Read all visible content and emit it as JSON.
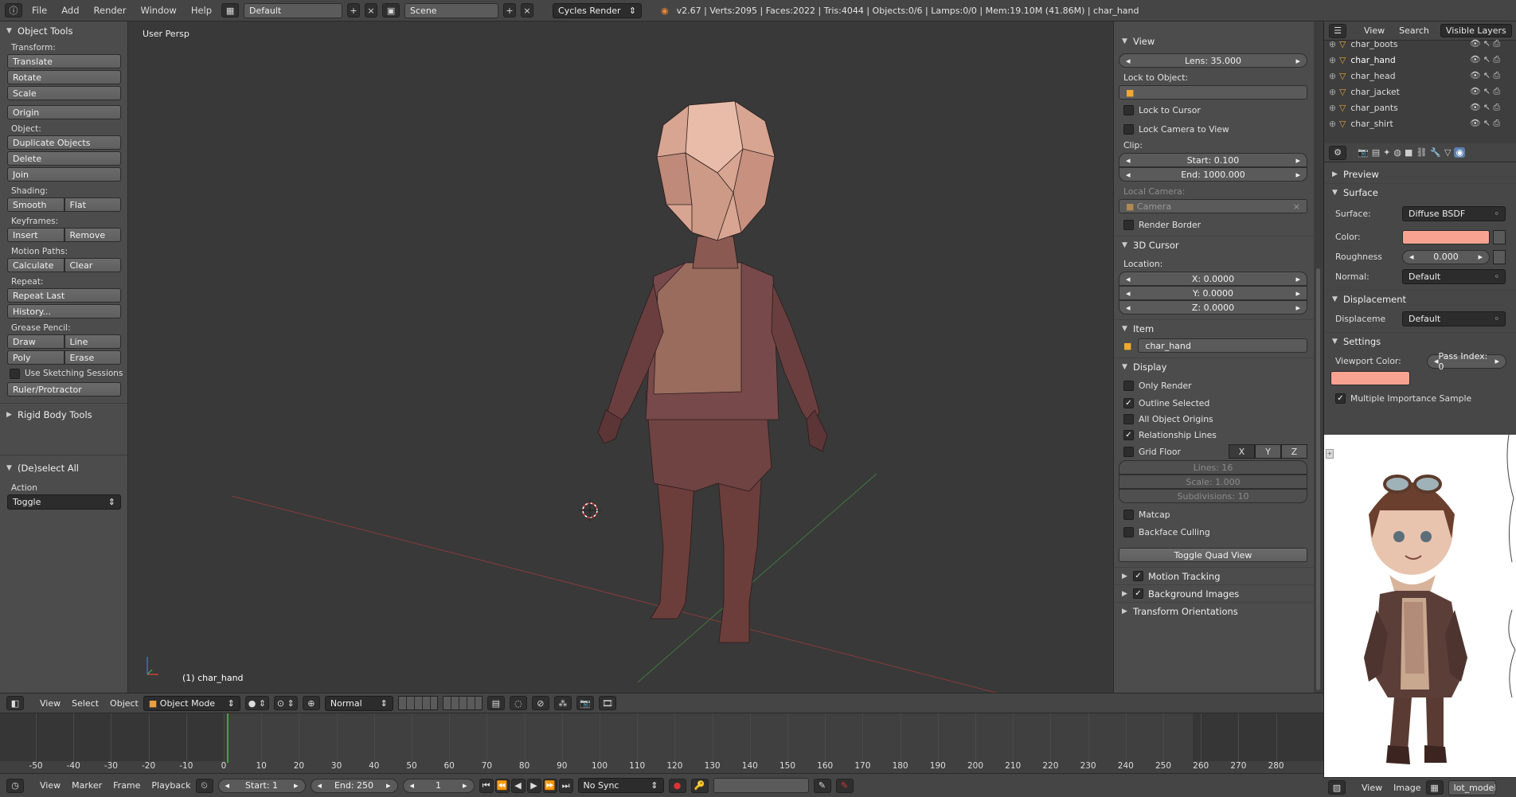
{
  "topbar": {
    "menus": [
      "File",
      "Add",
      "Render",
      "Window",
      "Help"
    ],
    "layout": "Default",
    "scene": "Scene",
    "engine": "Cycles Render",
    "stats": "v2.67 | Verts:2095 | Faces:2022 | Tris:4044 | Objects:0/6 | Lamps:0/0 | Mem:19.10M (41.86M) | char_hand"
  },
  "toolshelf": {
    "title": "Object Tools",
    "transform_label": "Transform:",
    "translate": "Translate",
    "rotate": "Rotate",
    "scale": "Scale",
    "origin": "Origin",
    "object_label": "Object:",
    "duplicate": "Duplicate Objects",
    "delete": "Delete",
    "join": "Join",
    "shading_label": "Shading:",
    "smooth": "Smooth",
    "flat": "Flat",
    "keyframes_label": "Keyframes:",
    "insert": "Insert",
    "remove": "Remove",
    "motion_label": "Motion Paths:",
    "calculate": "Calculate",
    "clear": "Clear",
    "repeat_label": "Repeat:",
    "repeat_last": "Repeat Last",
    "history": "History...",
    "grease_label": "Grease Pencil:",
    "draw": "Draw",
    "line": "Line",
    "poly": "Poly",
    "erase": "Erase",
    "sketching": "Use Sketching Sessions",
    "ruler": "Ruler/Protractor",
    "rigid": "Rigid Body Tools",
    "deselect_title": "(De)select All",
    "action_label": "Action",
    "action_value": "Toggle"
  },
  "viewport": {
    "view_name": "User Persp",
    "object_name": "(1) char_hand"
  },
  "npanel": {
    "view_title": "View",
    "lens": "Lens: 35.000",
    "lock_object": "Lock to Object:",
    "lock_cursor": "Lock to Cursor",
    "lock_camera": "Lock Camera to View",
    "clip": "Clip:",
    "clip_start": "Start: 0.100",
    "clip_end": "End: 1000.000",
    "local_camera": "Local Camera:",
    "camera": "Camera",
    "render_border": "Render Border",
    "cursor_title": "3D Cursor",
    "location": "Location:",
    "x": "X: 0.0000",
    "y": "Y: 0.0000",
    "z": "Z: 0.0000",
    "item_title": "Item",
    "item_name": "char_hand",
    "display_title": "Display",
    "only_render": "Only Render",
    "outline_selected": "Outline Selected",
    "all_origins": "All Object Origins",
    "relationship_lines": "Relationship Lines",
    "grid_floor": "Grid Floor",
    "axis_x": "X",
    "axis_y": "Y",
    "axis_z": "Z",
    "lines": "Lines: 16",
    "grid_scale": "Scale: 1.000",
    "subdivisions": "Subdivisions: 10",
    "matcap": "Matcap",
    "backface": "Backface Culling",
    "quad_view": "Toggle Quad View",
    "motion_tracking": "Motion Tracking",
    "background_images": "Background Images",
    "transform_orient": "Transform Orientations"
  },
  "outliner": {
    "view": "View",
    "search": "Search",
    "filter": "Visible Layers",
    "items": [
      "char_boots",
      "char_hand",
      "char_head",
      "char_jacket",
      "char_pants",
      "char_shirt"
    ]
  },
  "properties": {
    "preview": "Preview",
    "surface_title": "Surface",
    "surface_label": "Surface:",
    "surface_value": "Diffuse BSDF",
    "color_label": "Color:",
    "color_value": "#f8a392",
    "roughness_label": "Roughness",
    "roughness_value": "0.000",
    "normal_label": "Normal:",
    "normal_value": "Default",
    "displacement_title": "Displacement",
    "displacement_label": "Displaceme",
    "displacement_value": "Default",
    "settings_title": "Settings",
    "viewport_color": "Viewport Color:",
    "pass_index": "Pass Index: 0",
    "mis": "Multiple Importance Sample"
  },
  "image_editor": {
    "view": "View",
    "image": "Image",
    "image_name": "lot_model"
  },
  "timeline": {
    "menus": [
      "View",
      "Marker",
      "Frame",
      "Playback"
    ],
    "start": "Start: 1",
    "end": "End: 250",
    "current": "1",
    "sync": "No Sync",
    "header_menus": [
      "View",
      "Select",
      "Object"
    ],
    "mode": "Object Mode",
    "pivot": "Normal",
    "ticks": [
      "-50",
      "-40",
      "-30",
      "-20",
      "-10",
      "0",
      "10",
      "20",
      "30",
      "40",
      "50",
      "60",
      "70",
      "80",
      "90",
      "100",
      "110",
      "120",
      "130",
      "140",
      "150",
      "160",
      "170",
      "180",
      "190",
      "200",
      "210",
      "220",
      "230",
      "240",
      "250",
      "260",
      "270",
      "280"
    ]
  },
  "colors": {
    "accent": "#f8a392",
    "selected_text": "#ffffff",
    "frame_marker": "#3aa83a"
  }
}
